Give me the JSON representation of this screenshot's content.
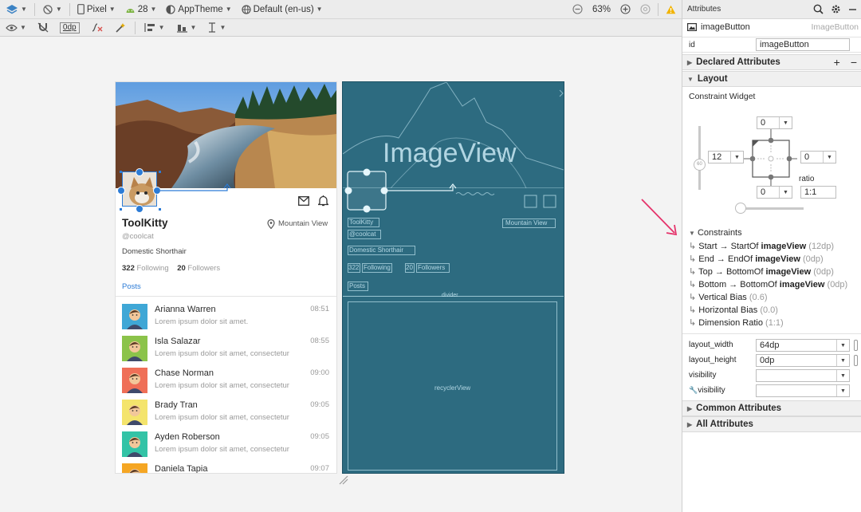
{
  "toolbar": {
    "device": "Pixel",
    "api_level": "28",
    "theme": "AppTheme",
    "locale": "Default (en-us)",
    "zoom": "63%",
    "margin": "0dp"
  },
  "design": {
    "profile_name": "ToolKitty",
    "handle": "@coolcat",
    "location": "Mountain View",
    "breed": "Domestic Shorthair",
    "following_count": "322",
    "following_label": "Following",
    "followers_count": "20",
    "followers_label": "Followers",
    "posts_label": "Posts",
    "contacts": [
      {
        "name": "Arianna Warren",
        "time": "08:51",
        "snippet": "Lorem ipsum dolor sit amet.",
        "bg": "#3fa7d6"
      },
      {
        "name": "Isla Salazar",
        "time": "08:55",
        "snippet": "Lorem ipsum dolor sit amet, consectetur",
        "bg": "#8bc34a"
      },
      {
        "name": "Chase Norman",
        "time": "09:00",
        "snippet": "Lorem ipsum dolor sit amet, consectetur",
        "bg": "#ef6f57"
      },
      {
        "name": "Brady Tran",
        "time": "09:05",
        "snippet": "Lorem ipsum dolor sit amet, consectetur",
        "bg": "#f4e46c"
      },
      {
        "name": "Ayden Roberson",
        "time": "09:05",
        "snippet": "Lorem ipsum dolor sit amet, consectetur",
        "bg": "#33c3a6"
      },
      {
        "name": "Daniela Tapia",
        "time": "09:07",
        "snippet": "",
        "bg": "#f5a623"
      }
    ]
  },
  "blueprint": {
    "image_label": "ImageView",
    "recycler_label": "recyclerView",
    "divider_label": "divider",
    "labels": {
      "name": "ToolKitty",
      "handle": "@coolcat",
      "location": "Mountain View",
      "breed": "Domestic Shorthair",
      "count1": "322",
      "following": "Following",
      "count2": "20",
      "followers": "Followers",
      "posts": "Posts"
    }
  },
  "panel": {
    "title": "Attributes",
    "widget_name": "imageButton",
    "widget_type": "ImageButton",
    "id_label": "id",
    "id_value": "imageButton",
    "declared": "Declared Attributes",
    "layout": "Layout",
    "constraint_widget": "Constraint Widget",
    "top_margin": "0",
    "left_margin": "12",
    "right_margin": "0",
    "bottom_margin": "0",
    "bias_value": "60",
    "ratio_label": "ratio",
    "ratio_value": "1:1",
    "constraints_header": "Constraints",
    "constraints": [
      {
        "a": "Start",
        "b": "StartOf",
        "target": "imageView",
        "val": "(12dp)"
      },
      {
        "a": "End",
        "b": "EndOf",
        "target": "imageView",
        "val": "(0dp)"
      },
      {
        "a": "Top",
        "b": "BottomOf",
        "target": "imageView",
        "val": "(0dp)"
      },
      {
        "a": "Bottom",
        "b": "BottomOf",
        "target": "imageView",
        "val": "(0dp)"
      },
      {
        "a": "Vertical Bias",
        "b": "",
        "target": "",
        "val": "(0.6)"
      },
      {
        "a": "Horizontal Bias",
        "b": "",
        "target": "",
        "val": "(0.0)"
      },
      {
        "a": "Dimension Ratio",
        "b": "",
        "target": "",
        "val": "(1:1)"
      }
    ],
    "attrs": [
      {
        "label": "layout_width",
        "value": "64dp"
      },
      {
        "label": "layout_height",
        "value": "0dp"
      },
      {
        "label": "visibility",
        "value": ""
      },
      {
        "label": "visibility",
        "value": ""
      }
    ],
    "common": "Common Attributes",
    "all": "All Attributes"
  },
  "colors": {
    "accent": "#2b7bd6",
    "blueprint": "#2d6b80",
    "arrow": "#e5336b"
  }
}
